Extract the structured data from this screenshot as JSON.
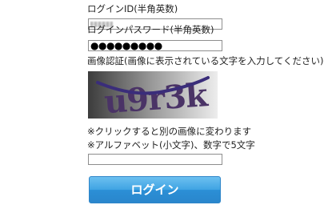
{
  "login_form": {
    "id_label": "ログインID(半角英数)",
    "id_value": "",
    "password_label": "ログインパスワード(半角英数)",
    "password_mask": "●●●●●●●●●",
    "captcha_label": "画像認証(画像に表示されている文字を入力してください)",
    "captcha_text": "u9r3k",
    "captcha_hint_1": "※クリックすると別の画像に変わります",
    "captcha_hint_2": "※アルファベット(小文字)、数字で5文字",
    "captcha_input_value": "",
    "login_button": "ログイン"
  },
  "colors": {
    "button_top": "#6cc0f0",
    "button_bottom": "#2a86cc",
    "captcha_text": "#4a3366",
    "captcha_line": "#3a2d7a"
  }
}
